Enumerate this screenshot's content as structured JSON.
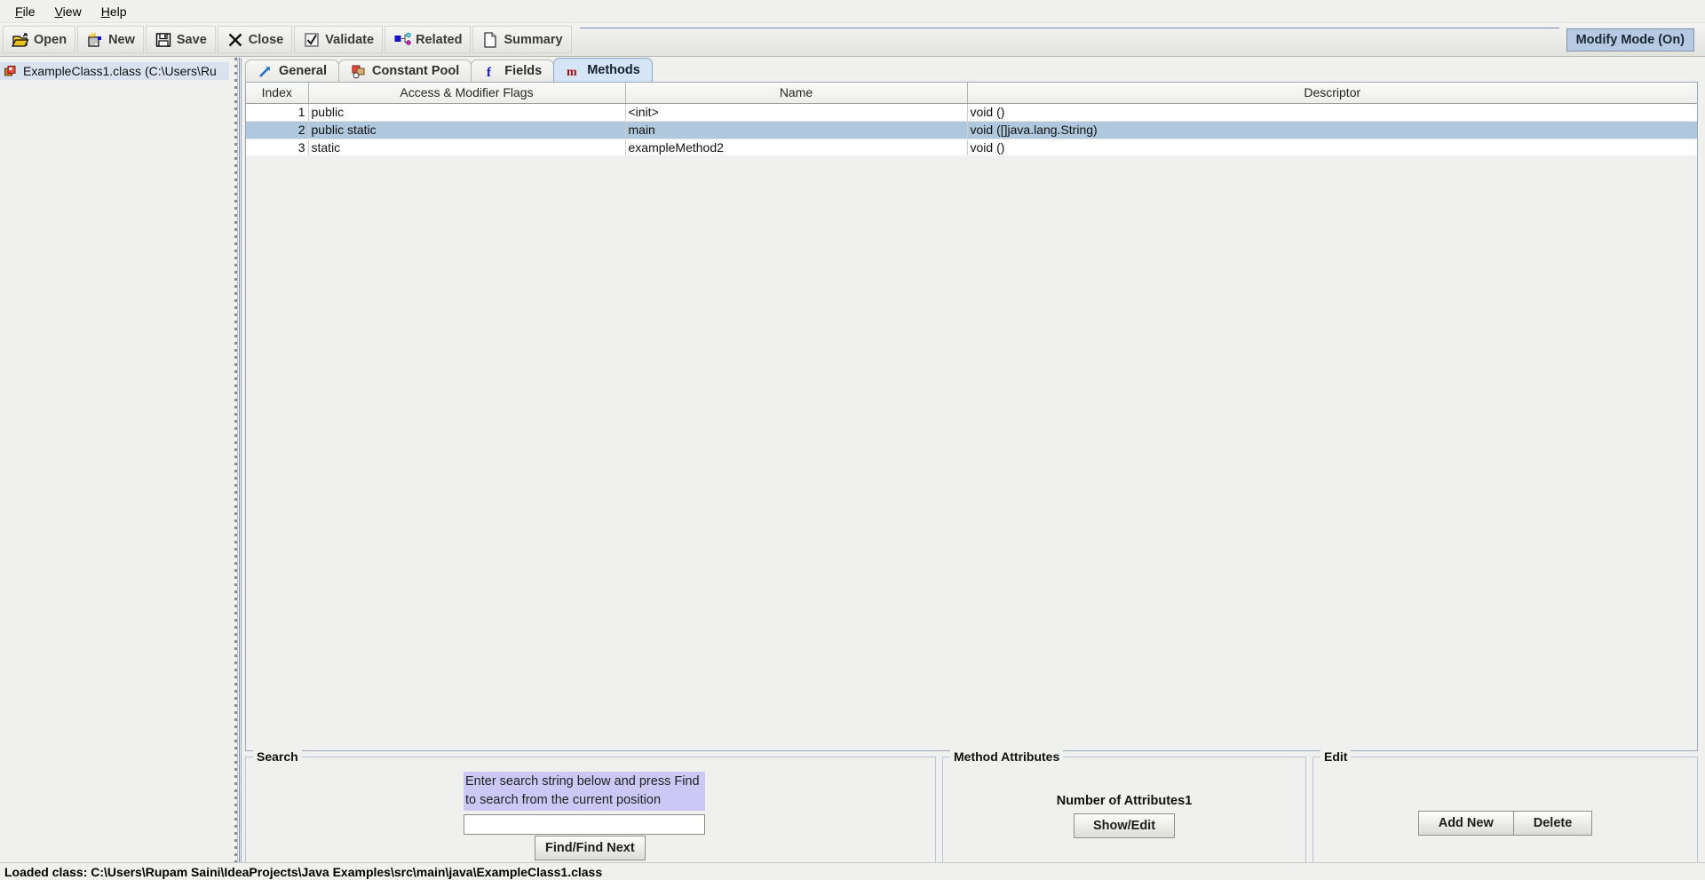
{
  "menubar": {
    "items": [
      {
        "label": "File",
        "mnemonic": "F"
      },
      {
        "label": "View",
        "mnemonic": "V"
      },
      {
        "label": "Help",
        "mnemonic": "H"
      }
    ]
  },
  "toolbar": {
    "buttons": [
      {
        "label": "Open",
        "icon": "open-folder-icon"
      },
      {
        "label": "New",
        "icon": "new-file-icon"
      },
      {
        "label": "Save",
        "icon": "floppy-disk-icon"
      },
      {
        "label": "Close",
        "icon": "close-x-icon"
      },
      {
        "label": "Validate",
        "icon": "checkbox-icon"
      },
      {
        "label": "Related",
        "icon": "related-nodes-icon"
      },
      {
        "label": "Summary",
        "icon": "document-icon"
      }
    ],
    "modify_mode_label": "Modify Mode (On)",
    "modify_mode_bg": "#b6cae4"
  },
  "sidebar": {
    "tree": [
      {
        "label": "ExampleClass1.class (C:\\Users\\Ru",
        "icon": "java-class-icon",
        "selected": true
      }
    ]
  },
  "tabs": [
    {
      "label": "General",
      "icon": "arrow-up-right-icon",
      "active": false
    },
    {
      "label": "Constant Pool",
      "icon": "constant-pool-icon",
      "active": false
    },
    {
      "label": "Fields",
      "icon": "fields-f-icon",
      "active": false
    },
    {
      "label": "Methods",
      "icon": "methods-m-icon",
      "active": true
    }
  ],
  "table": {
    "columns": [
      "Index",
      "Access & Modifier Flags",
      "Name",
      "Descriptor"
    ],
    "rows": [
      {
        "index": "1",
        "flags": "public",
        "name": "<init>",
        "descriptor": "void ()",
        "selected": false
      },
      {
        "index": "2",
        "flags": "public static",
        "name": "main",
        "descriptor": "void ([]java.lang.String)",
        "selected": true
      },
      {
        "index": "3",
        "flags": "static",
        "name": "exampleMethod2",
        "descriptor": "void ()",
        "selected": false
      }
    ],
    "selected_row_color": "#afc8dd"
  },
  "search_panel": {
    "legend": "Search",
    "hint_line1": "Enter search string below and press Find",
    "hint_line2": "to search from the current position",
    "hint_bg": "#cdc7f5",
    "input_value": "",
    "input_placeholder": "",
    "find_button": "Find/Find Next"
  },
  "method_attributes_panel": {
    "legend": "Method Attributes",
    "count_label": "Number of Attributes",
    "count_value": "1",
    "show_edit_button": "Show/Edit"
  },
  "edit_panel": {
    "legend": "Edit",
    "add_new_button": "Add New",
    "delete_button": "Delete"
  },
  "statusbar": {
    "text": "Loaded class: C:\\Users\\Rupam Saini\\IdeaProjects\\Java Examples\\src\\main\\java\\ExampleClass1.class"
  }
}
